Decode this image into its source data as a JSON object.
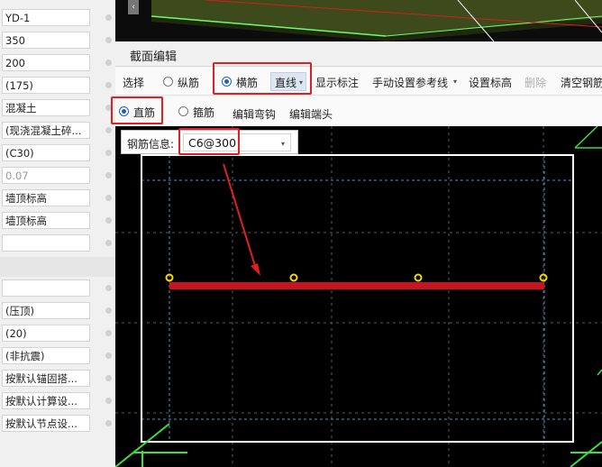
{
  "properties": [
    {
      "value": "YD-1",
      "dimmed": false
    },
    {
      "value": "350",
      "dimmed": false
    },
    {
      "value": "200",
      "dimmed": false
    },
    {
      "value": "(175)",
      "dimmed": false
    },
    {
      "value": "混凝土",
      "dimmed": false
    },
    {
      "value": "(现浇混凝土碎...",
      "dimmed": false
    },
    {
      "value": "(C30)",
      "dimmed": false
    },
    {
      "value": "0.07",
      "dimmed": true
    },
    {
      "value": "墙顶标高",
      "dimmed": false
    },
    {
      "value": "墙顶标高",
      "dimmed": false
    },
    {
      "value": "",
      "dimmed": false
    },
    {
      "value": "",
      "dimmed": false
    },
    {
      "value": "(压顶)",
      "dimmed": false
    },
    {
      "value": "(20)",
      "dimmed": false
    },
    {
      "value": "(非抗震)",
      "dimmed": false
    },
    {
      "value": "按默认锚固搭...",
      "dimmed": false
    },
    {
      "value": "按默认计算设...",
      "dimmed": false
    },
    {
      "value": "按默认节点设...",
      "dimmed": false
    }
  ],
  "dialog": {
    "title": "截面编辑",
    "toolbar1": {
      "select": "选择",
      "longitudinal": "纵筋",
      "transverse": "横筋",
      "line_mode": "直线",
      "show_dimension": "显示标注",
      "manual_ref_line": "手动设置参考线",
      "set_elevation": "设置标高",
      "delete": "删除",
      "clear_rebar": "清空钢筋"
    },
    "toolbar2": {
      "straight": "直筋",
      "stirrup": "箍筋",
      "edit_hook": "编辑弯钩",
      "edit_end": "编辑端头"
    },
    "rebar_info": {
      "label": "钢筋信息:",
      "value": "C6@300"
    }
  },
  "colors": {
    "highlight": "#e02020",
    "rebar": "#c8141e",
    "point": "#f5d800",
    "section_outline": "#ffffff",
    "guide": "#4a90d9",
    "grid_3d": "#33dd33"
  }
}
